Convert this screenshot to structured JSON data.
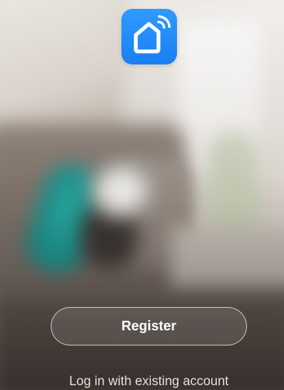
{
  "app": {
    "logo_icon": "smart-home-wifi-icon",
    "accent_color": "#1a7ef2"
  },
  "actions": {
    "register_label": "Register",
    "login_label": "Log in with existing account"
  }
}
